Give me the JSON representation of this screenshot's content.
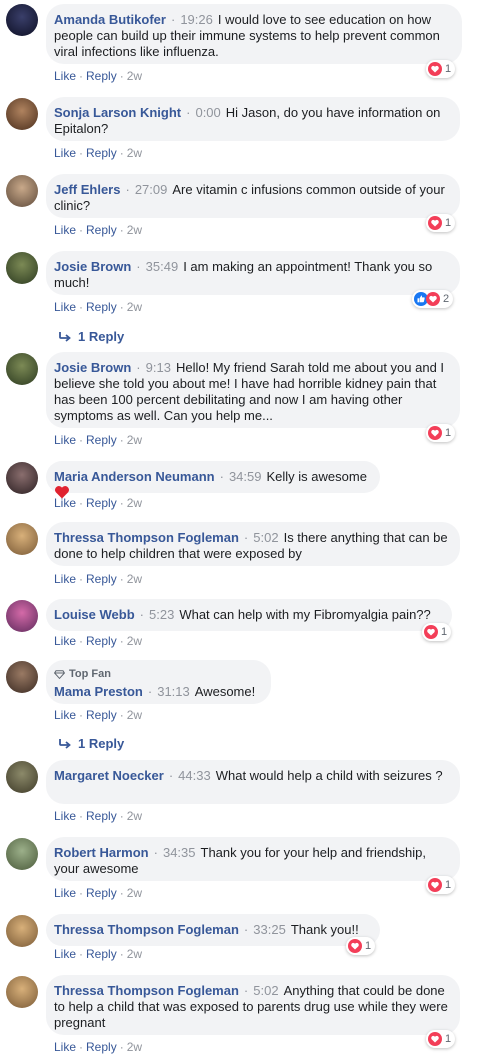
{
  "comments": [
    {
      "author": "Amanda Butikofer",
      "time": "19:26",
      "text": "I would love to see education on how people can build up their immune systems to help prevent common viral infections like influenza.",
      "like": "Like",
      "reply": "Reply",
      "age": "2w",
      "reaction_count": "1"
    },
    {
      "author": "Sonja Larson Knight",
      "time": "0:00",
      "text": "Hi Jason, do you have information on Epitalon?",
      "like": "Like",
      "reply": "Reply",
      "age": "2w"
    },
    {
      "author": "Jeff Ehlers",
      "time": "27:09",
      "text": "Are vitamin c infusions common outside of your clinic?",
      "like": "Like",
      "reply": "Reply",
      "age": "2w",
      "reaction_count": "1"
    },
    {
      "author": "Josie Brown",
      "time": "35:49",
      "text": "I am making an appointment! Thank you so much!",
      "like": "Like",
      "reply": "Reply",
      "age": "2w",
      "reaction_count": "2"
    },
    {
      "author": "Josie Brown",
      "time": "9:13",
      "text": "Hello! My friend Sarah told me about you and I believe she told you about me! I have had horrible kidney pain that has been 100 percent debilitating and now I am having other symptoms as well. Can you help me...",
      "like": "Like",
      "reply": "Reply",
      "age": "2w",
      "reaction_count": "1"
    },
    {
      "author": "Maria Anderson Neumann",
      "time": "34:59",
      "text": "Kelly is awesome",
      "like": "Like",
      "reply": "Reply",
      "age": "2w"
    },
    {
      "author": "Thressa Thompson Fogleman",
      "time": "5:02",
      "text": "Is there anything that can be done to help children that were exposed by",
      "like": "Like",
      "reply": "Reply",
      "age": "2w"
    },
    {
      "author": "Louise Webb",
      "time": "5:23",
      "text": "What can help with my Fibromyalgia pain??",
      "like": "Like",
      "reply": "Reply",
      "age": "2w",
      "reaction_count": "1"
    },
    {
      "author": "Mama Preston",
      "badge": "Top Fan",
      "time": "31:13",
      "text": "Awesome!",
      "like": "Like",
      "reply": "Reply",
      "age": "2w"
    },
    {
      "author": "Margaret Noecker",
      "time": "44:33",
      "text": "What would help a child with seizures ?",
      "like": "Like",
      "reply": "Reply",
      "age": "2w"
    },
    {
      "author": "Robert Harmon",
      "time": "34:35",
      "text": "Thank you for your help and friendship, your awesome",
      "like": "Like",
      "reply": "Reply",
      "age": "2w",
      "reaction_count": "1"
    },
    {
      "author": "Thressa Thompson Fogleman",
      "time": "33:25",
      "text": "Thank you!!",
      "like": "Like",
      "reply": "Reply",
      "age": "2w",
      "reaction_count": "1"
    },
    {
      "author": "Thressa Thompson Fogleman",
      "time": "5:02",
      "text": "Anything that could be done to help a child that was exposed to parents drug use while they were pregnant",
      "like": "Like",
      "reply": "Reply",
      "age": "2w",
      "reaction_count": "1"
    }
  ],
  "reply_threads": [
    {
      "label": "1 Reply"
    },
    {
      "label": "1 Reply"
    }
  ],
  "separator": "·",
  "colors": {
    "link": "#385898",
    "bubble": "#f2f3f5",
    "love": "#f33e58",
    "like": "#1877f2",
    "meta": "#90949c"
  }
}
